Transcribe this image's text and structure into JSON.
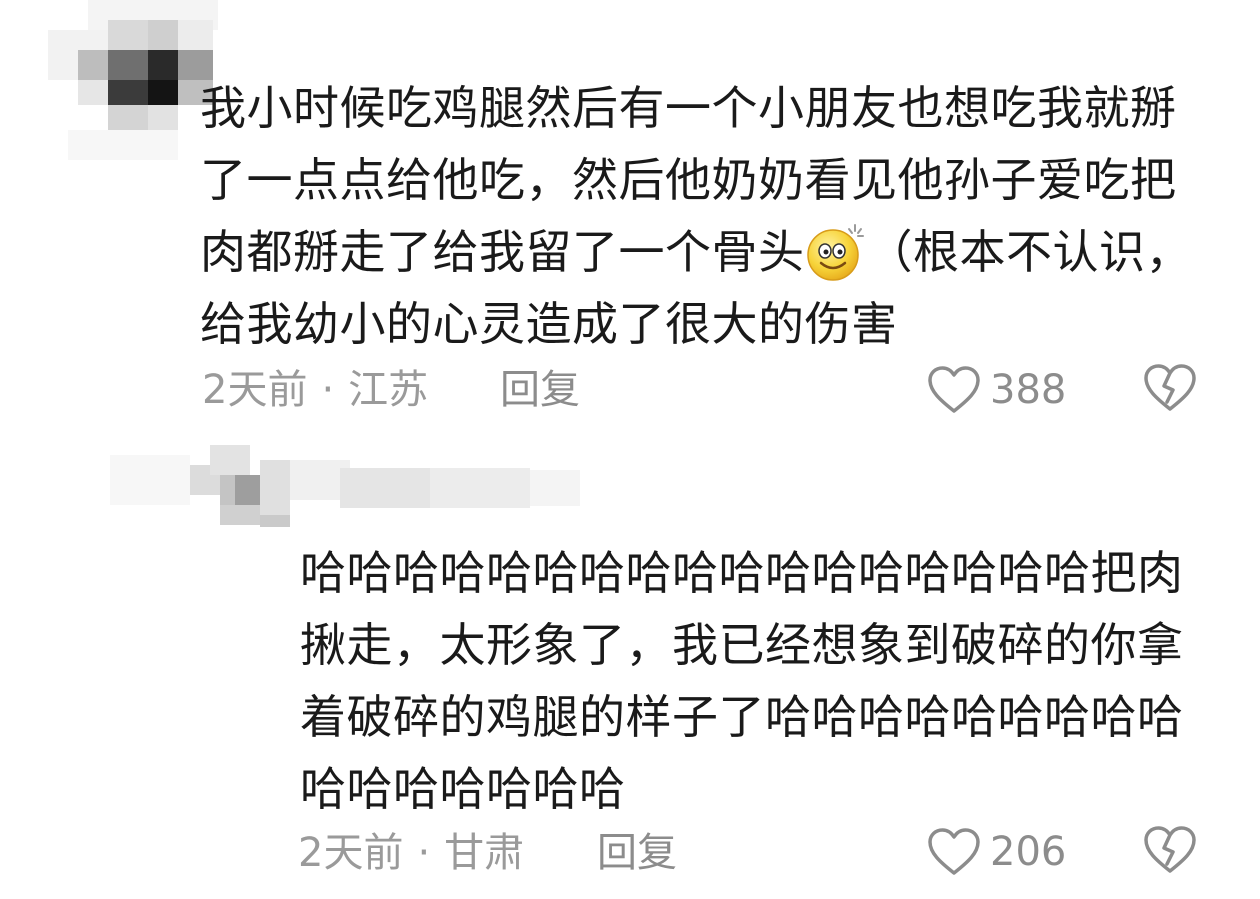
{
  "comments": [
    {
      "text_before_emoji": "我小时候吃鸡腿然后有一个小朋友也想吃我就掰了一点点给他吃，然后他奶奶看见他孙子爱吃把肉都掰走了给我留了一个骨头",
      "emoji": "dizzy-smile-emoji",
      "text_after_emoji": "（根本不认识，给我幼小的心灵造成了很大的伤害",
      "time": "2天前",
      "location": "江苏",
      "reply_label": "回复",
      "likes": "388"
    },
    {
      "text": "哈哈哈哈哈哈哈哈哈哈哈哈哈哈哈哈哈把肉揪走，太形象了，我已经想象到破碎的你拿着破碎的鸡腿的样子了哈哈哈哈哈哈哈哈哈哈哈哈哈哈哈哈",
      "time": "2天前",
      "location": "甘肃",
      "reply_label": "回复",
      "likes": "206"
    }
  ],
  "colors": {
    "text": "#1a1a1a",
    "meta": "#9a9a9a",
    "icon": "#8c8c8c"
  }
}
